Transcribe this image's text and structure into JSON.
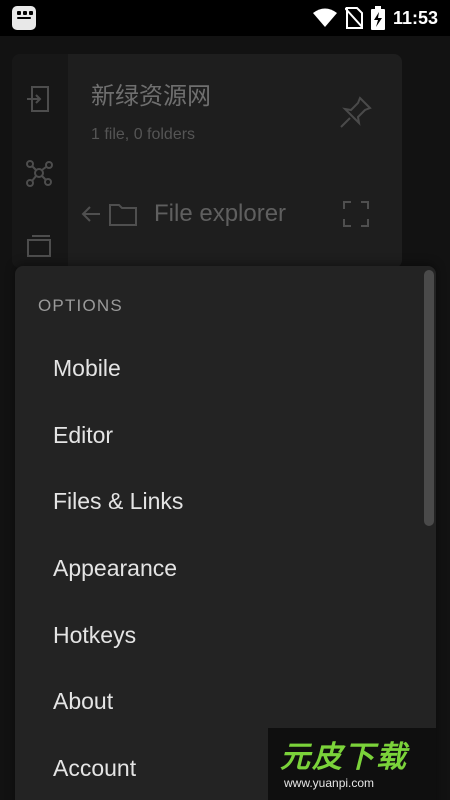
{
  "status_bar": {
    "time": "11:53"
  },
  "vault": {
    "name": "新绿资源网",
    "summary": "1 file, 0 folders"
  },
  "explorer": {
    "title": "File explorer"
  },
  "options": {
    "header": "OPTIONS",
    "items": [
      {
        "label": "Mobile"
      },
      {
        "label": "Editor"
      },
      {
        "label": "Files & Links"
      },
      {
        "label": "Appearance"
      },
      {
        "label": "Hotkeys"
      },
      {
        "label": "About"
      },
      {
        "label": "Account"
      }
    ]
  },
  "watermark": {
    "text": "元皮下载",
    "url": "www.yuanpi.com"
  }
}
